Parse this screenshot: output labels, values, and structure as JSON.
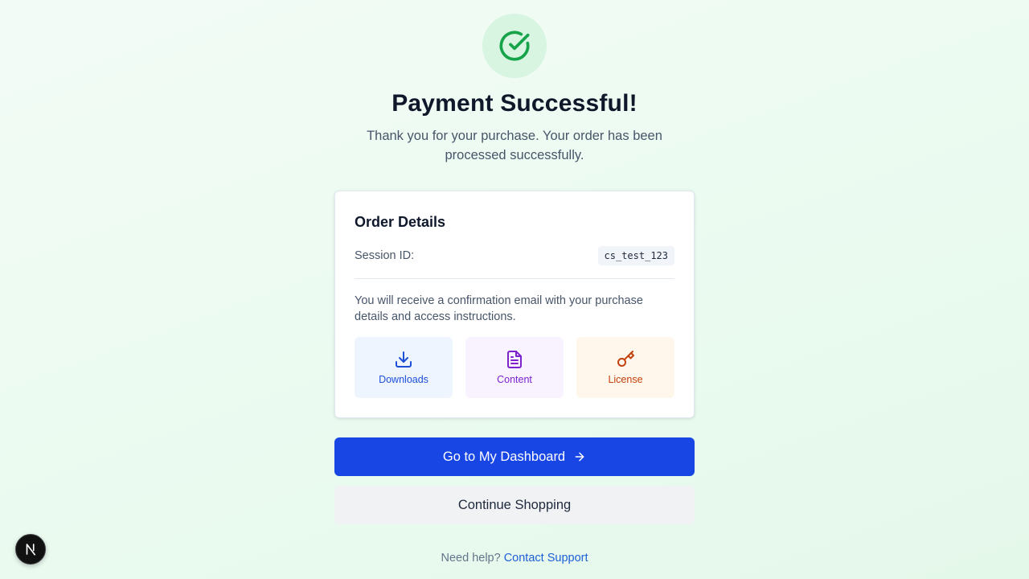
{
  "header": {
    "title": "Payment Successful!",
    "subtitle": "Thank you for your purchase. Your order has been processed successfully."
  },
  "order": {
    "title": "Order Details",
    "session_label": "Session ID:",
    "session_id": "cs_test_123",
    "confirmation": "You will receive a confirmation email with your purchase details and access instructions.",
    "tiles": [
      {
        "label": "Downloads",
        "icon": "download-icon",
        "color": "#1d4ed8"
      },
      {
        "label": "Content",
        "icon": "document-icon",
        "color": "#7e22ce"
      },
      {
        "label": "License",
        "icon": "key-icon",
        "color": "#c2410c"
      }
    ]
  },
  "actions": {
    "dashboard_label": "Go to My Dashboard",
    "continue_label": "Continue Shopping"
  },
  "help": {
    "prefix": "Need help?",
    "link_label": "Contact Support"
  },
  "colors": {
    "accent": "#1746e5",
    "success": "#16a34a"
  }
}
